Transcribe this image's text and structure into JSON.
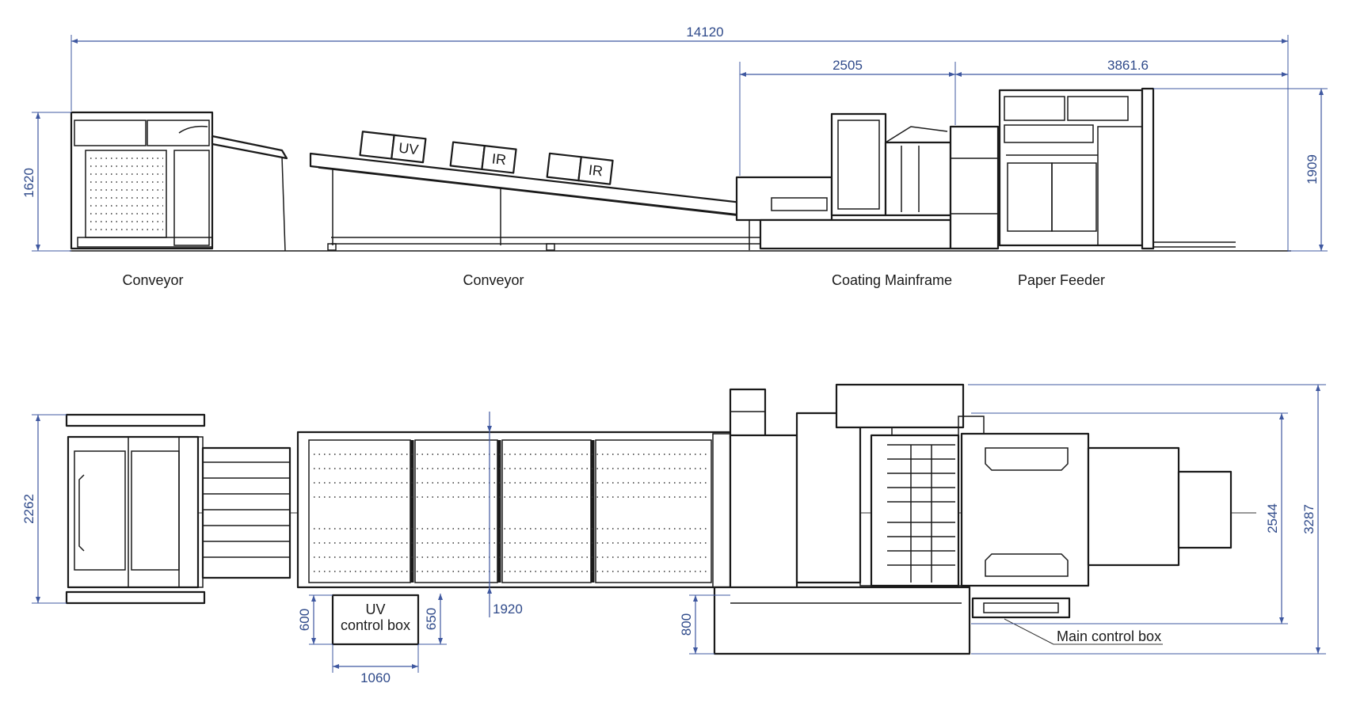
{
  "dimensions": {
    "overall_length": "14120",
    "coating_mainframe_length": "2505",
    "paper_feeder_length": "3861.6",
    "conveyor_height": "1620",
    "feeder_height": "1909",
    "conveyor_width": "2262",
    "dryer_width": "1920",
    "uv_box_width": "1060",
    "uv_box_height": "600",
    "uv_box_depth": "650",
    "mainframe_offset": "800",
    "feeder_width": "2544",
    "overall_width": "3287"
  },
  "side_view_labels": {
    "conveyor_delivery": "Conveyor",
    "conveyor_dryer": "Conveyor",
    "coating_mainframe": "Coating Mainframe",
    "paper_feeder": "Paper Feeder"
  },
  "lamp_labels": {
    "uv": "UV",
    "ir1": "IR",
    "ir2": "IR"
  },
  "top_view_labels": {
    "uv_control_box_line1": "UV",
    "uv_control_box_line2": "control box",
    "main_control_box": "Main control box"
  },
  "colors": {
    "dimension_lines": "#3f58a0",
    "dimension_text": "#2f4a8a",
    "drawing_lines": "#1a1a1a"
  }
}
